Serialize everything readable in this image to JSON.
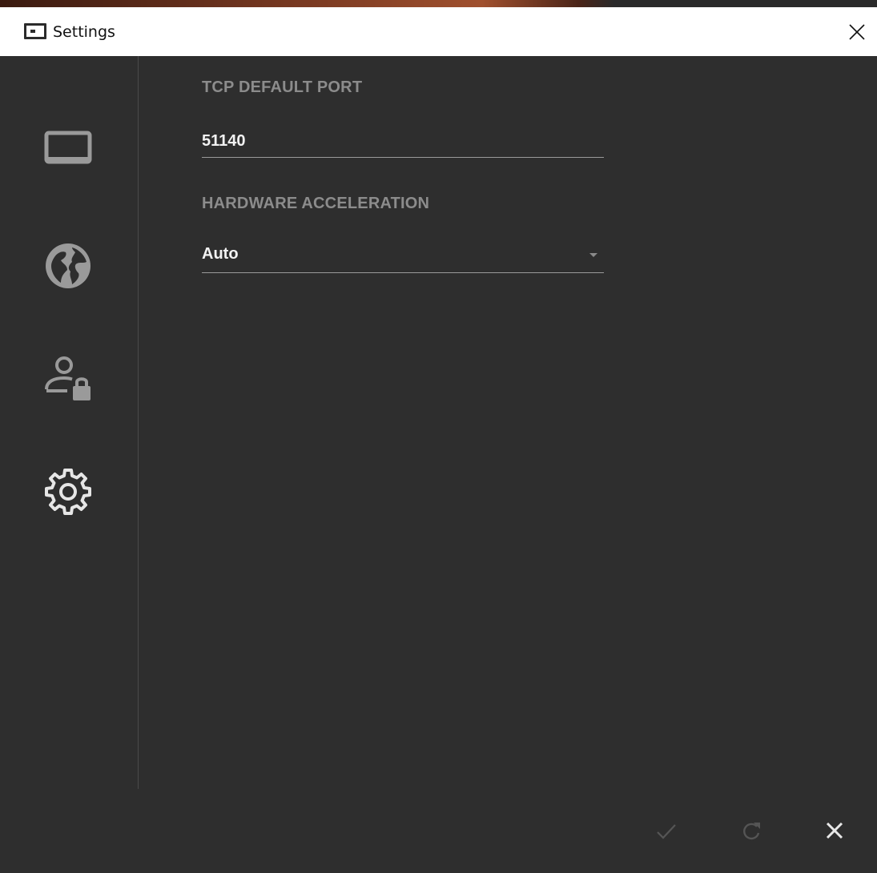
{
  "window": {
    "title": "Settings",
    "close_label": "×"
  },
  "sidebar": {
    "items": [
      {
        "name": "display",
        "icon": "monitor-icon"
      },
      {
        "name": "network",
        "icon": "globe-icon"
      },
      {
        "name": "security",
        "icon": "user-lock-icon"
      },
      {
        "name": "general",
        "icon": "gear-icon",
        "active": true
      }
    ]
  },
  "settings": {
    "tcp_port": {
      "label": "TCP DEFAULT PORT",
      "value": "51140"
    },
    "hardware_acceleration": {
      "label": "HARDWARE ACCELERATION",
      "selected": "Auto"
    }
  },
  "footer": {
    "buttons": [
      {
        "name": "apply",
        "icon": "check-icon"
      },
      {
        "name": "reset",
        "icon": "refresh-icon"
      },
      {
        "name": "cancel",
        "icon": "close-icon"
      }
    ]
  },
  "colors": {
    "background": "#2e2e2e",
    "label": "#8c8c8c",
    "value": "#f2f2f2",
    "icon": "#9a9a9a",
    "icon_active": "#e6e6e6"
  }
}
